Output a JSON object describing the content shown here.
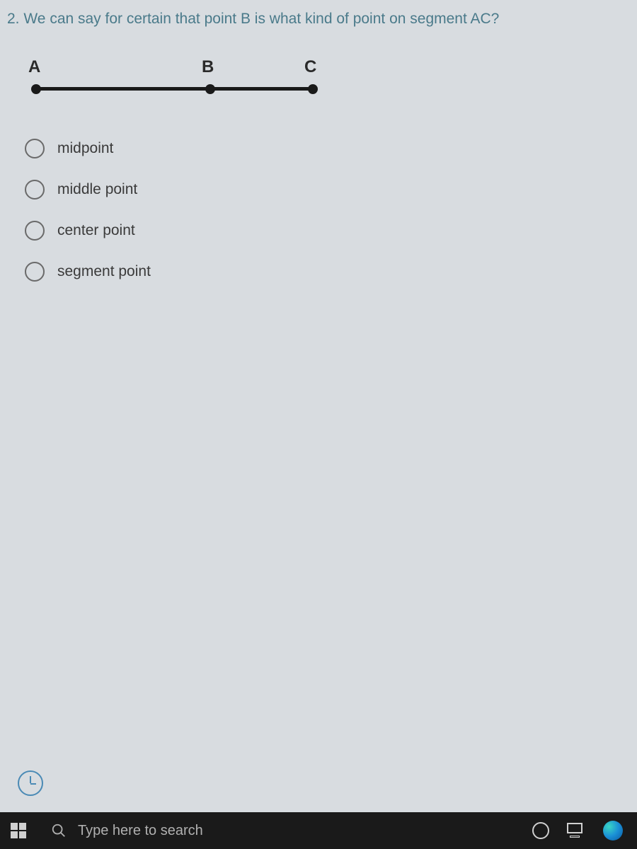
{
  "question": {
    "number": "2.",
    "text": "We can say for certain that point B is what kind of point on segment AC?",
    "diagram": {
      "points": [
        "A",
        "B",
        "C"
      ]
    },
    "options": [
      "midpoint",
      "middle point",
      "center point",
      "segment point"
    ]
  },
  "taskbar": {
    "search_placeholder": "Type here to search"
  }
}
